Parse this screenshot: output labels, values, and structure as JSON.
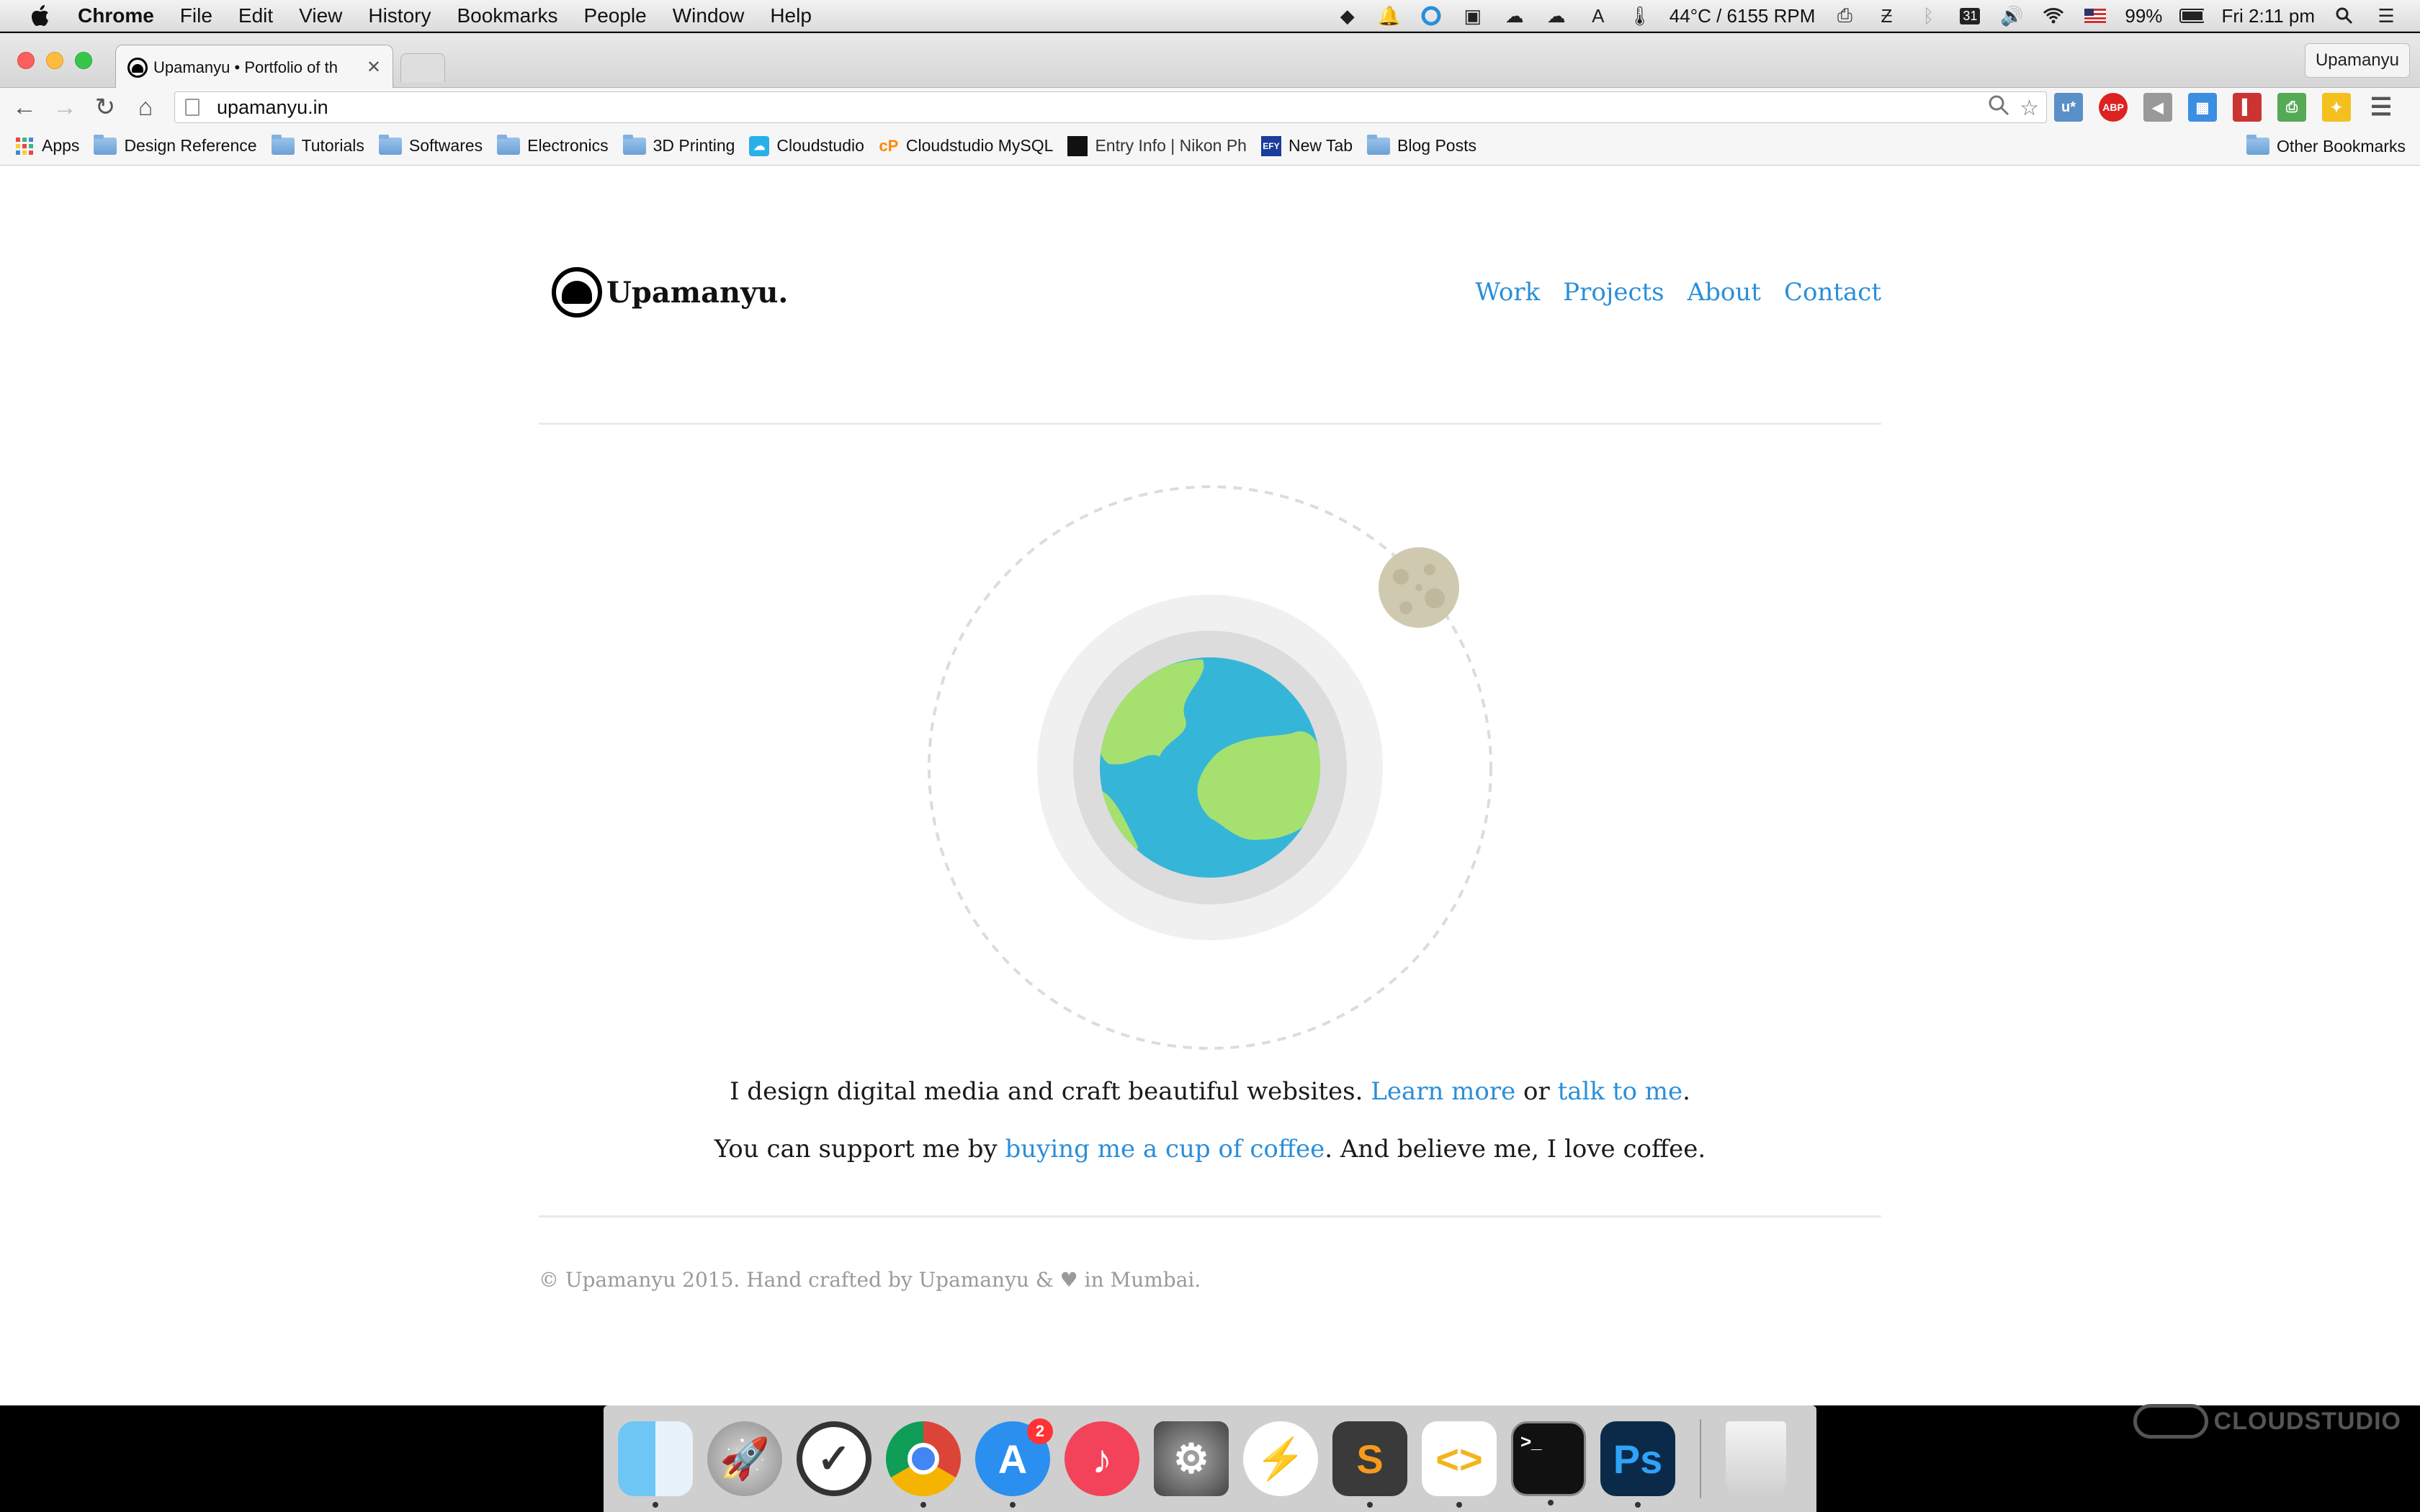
{
  "menubar": {
    "app": "Chrome",
    "items": [
      "File",
      "Edit",
      "View",
      "History",
      "Bookmarks",
      "People",
      "Window",
      "Help"
    ],
    "temp_rpm": "44°C / 6155 RPM",
    "calendar_day": "31",
    "battery": "99%",
    "clock": "Fri 2:11 pm"
  },
  "browser": {
    "tab_title": "Upamanyu • Portfolio of th",
    "profile": "Upamanyu",
    "url": "upamanyu.in",
    "bookmarks": [
      {
        "label": "Apps",
        "icon": "apps-grid-icon"
      },
      {
        "label": "Design Reference",
        "icon": "folder-icon"
      },
      {
        "label": "Tutorials",
        "icon": "folder-icon"
      },
      {
        "label": "Softwares",
        "icon": "folder-icon"
      },
      {
        "label": "Electronics",
        "icon": "folder-icon"
      },
      {
        "label": "3D Printing",
        "icon": "folder-icon"
      },
      {
        "label": "Cloudstudio",
        "icon": "cloudstudio-icon"
      },
      {
        "label": "Cloudstudio MySQL",
        "icon": "cpanel-icon"
      },
      {
        "label": "Entry Info | Nikon Ph",
        "icon": "nikon-icon"
      },
      {
        "label": "New Tab",
        "icon": "efy-icon"
      },
      {
        "label": "Blog Posts",
        "icon": "folder-icon"
      }
    ],
    "other_bookmarks": "Other Bookmarks",
    "ext_abp": "ABP",
    "ext_u": "u*"
  },
  "site": {
    "logo_text": "Upamanyu.",
    "nav": [
      "Work",
      "Projects",
      "About",
      "Contact"
    ],
    "line1_pre": "I design digital media and craft beautiful websites. ",
    "line1_link1": "Learn more",
    "line1_mid": " or ",
    "line1_link2": "talk to me",
    "line1_post": ".",
    "line2_pre": "You can support me by ",
    "line2_link": "buying me a cup of coffee",
    "line2_post": ". And believe me, I love coffee.",
    "footer": "© Upamanyu 2015. Hand crafted by Upamanyu & ♥ in Mumbai."
  },
  "colors": {
    "link": "#2a8ed9",
    "ocean": "#35b6d8",
    "land": "#a6e170",
    "moon": "#cfc9b0"
  },
  "dock": {
    "apps": [
      "Finder",
      "Launchpad",
      "Clock",
      "Chrome",
      "App Store",
      "iTunes",
      "System Preferences",
      "Messenger",
      "Sublime Text",
      "Coda",
      "Terminal",
      "Photoshop",
      "Trash"
    ],
    "appstore_badge": "2",
    "sublime_glyph": "S",
    "terminal_glyph": ">_",
    "photoshop_glyph": "Ps"
  },
  "watermark": "CLOUDSTUDIO"
}
